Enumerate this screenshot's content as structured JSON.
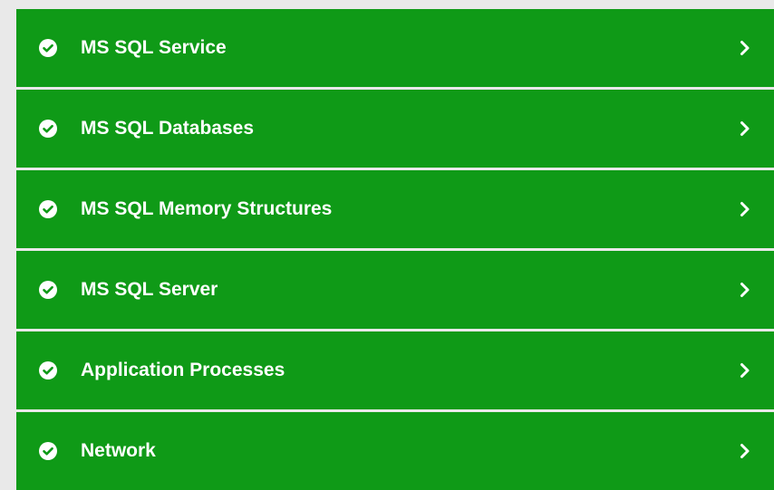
{
  "status_list": {
    "items": [
      {
        "label": "MS SQL Service",
        "status_icon": "check-circle-icon",
        "nav_icon": "chevron-right-icon"
      },
      {
        "label": "MS SQL Databases",
        "status_icon": "check-circle-icon",
        "nav_icon": "chevron-right-icon"
      },
      {
        "label": "MS SQL Memory Structures",
        "status_icon": "check-circle-icon",
        "nav_icon": "chevron-right-icon"
      },
      {
        "label": "MS SQL Server",
        "status_icon": "check-circle-icon",
        "nav_icon": "chevron-right-icon"
      },
      {
        "label": "Application Processes",
        "status_icon": "check-circle-icon",
        "nav_icon": "chevron-right-icon"
      },
      {
        "label": "Network",
        "status_icon": "check-circle-icon",
        "nav_icon": "chevron-right-icon"
      }
    ]
  },
  "colors": {
    "row_background": "#0f9a17",
    "text": "#ffffff",
    "page_background": "#e9e9e9"
  }
}
